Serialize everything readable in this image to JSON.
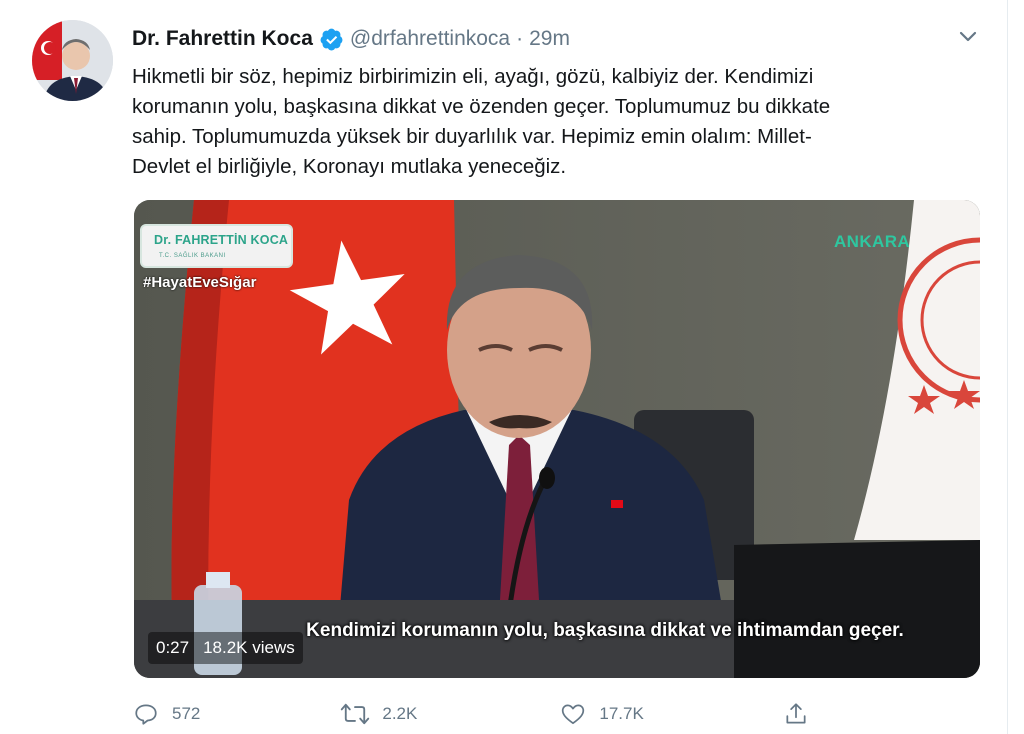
{
  "tweet": {
    "author_name": "Dr. Fahrettin Koca",
    "handle": "@drfahrettinkoca",
    "separator": "·",
    "time": "29m",
    "text_lines": [
      "Hikmetli bir söz, hepimiz birbirimizin eli, ayağı, gözü, kalbiyiz der. Kendimizi",
      "korumanın yolu, başkasına dikkat ve özenden geçer. Toplumumuz bu dikkate",
      "sahip. Toplumumuzda yüksek bir duyarlılık var. Hepimiz emin olalım: Millet-",
      "Devlet el birliğiyle, Koronayı mutlaka yeneceğiz."
    ]
  },
  "video": {
    "badge_name": "Dr. FAHRETTİN KOCA",
    "badge_sub": "T.C. SAĞLIK BAKANI",
    "hashtag": "#HayatEveSığar",
    "city": "ANKARA",
    "subtitle": "Kendimizi korumanın yolu, başkasına dikkat ve ihtimamdan geçer.",
    "elapsed": "0:27",
    "views": "18.2K views"
  },
  "actions": {
    "reply_count": "572",
    "retweet_count": "2.2K",
    "like_count": "17.7K"
  },
  "icons": {
    "verified": "verified-badge-icon",
    "caret": "chevron-down-icon",
    "reply": "reply-icon",
    "retweet": "retweet-icon",
    "like": "like-icon",
    "share": "share-icon"
  },
  "colors": {
    "verified": "#1da1f2",
    "secondary_text": "#657786",
    "flag_red": "#e30a17"
  }
}
